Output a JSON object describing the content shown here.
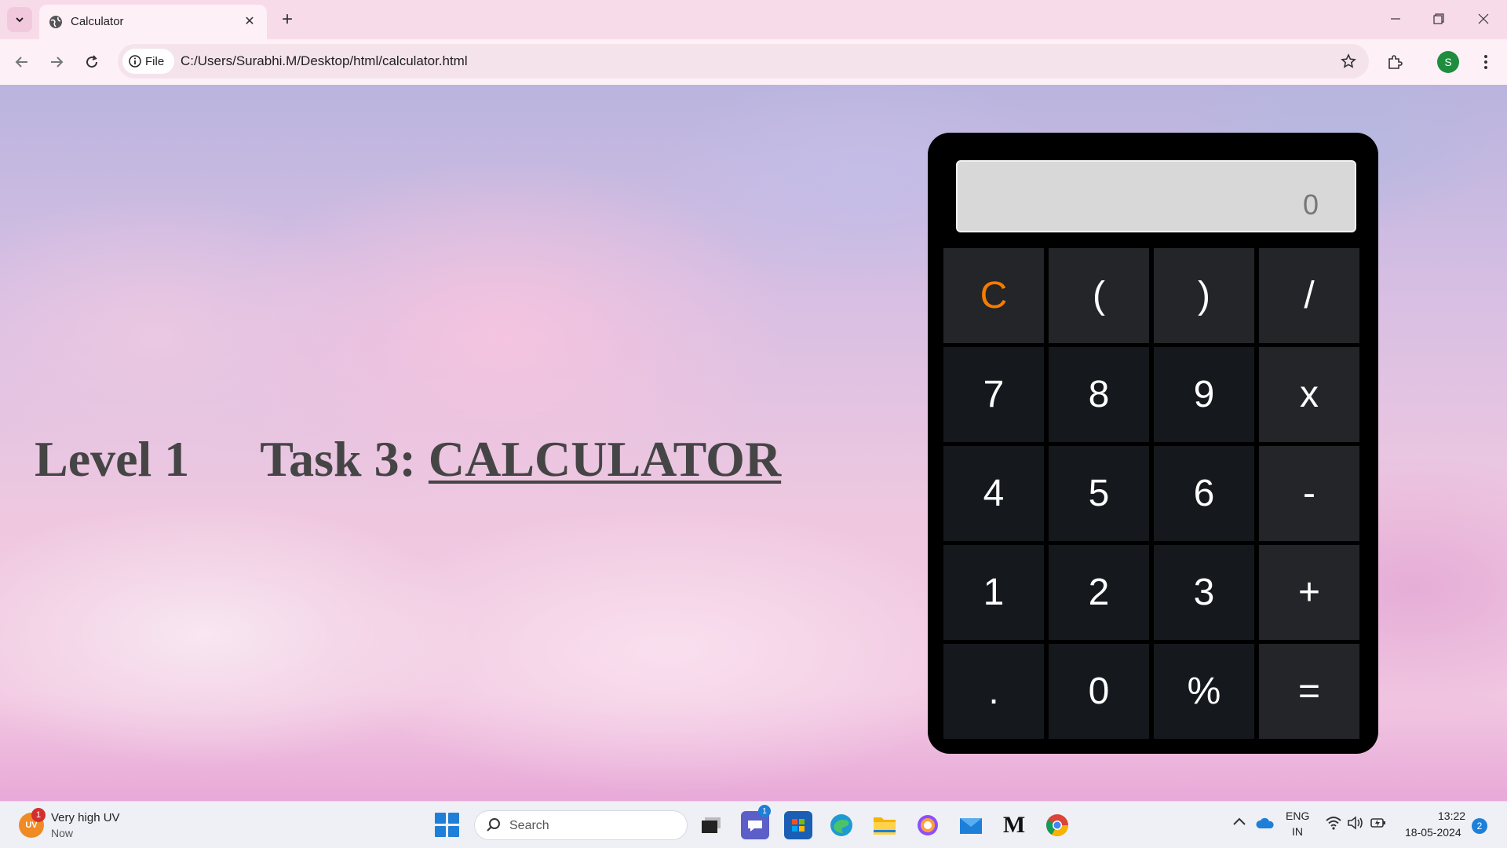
{
  "browser": {
    "tab_title": "Calculator",
    "tab_close": "✕",
    "new_tab": "+",
    "site_chip_label": "File",
    "url": "C:/Users/Surabhi.M/Desktop/html/calculator.html",
    "profile_initial": "S",
    "icons": [
      "tab-list-icon",
      "globe-icon",
      "back-icon",
      "forward-icon",
      "reload-icon",
      "info-icon",
      "star-icon",
      "extensions-icon",
      "menu-icon",
      "minimize-icon",
      "restore-icon",
      "close-icon"
    ]
  },
  "page": {
    "level_text": "Level 1",
    "task_prefix": "Task 3: ",
    "task_title": "CALCULATOR"
  },
  "calculator": {
    "display_value": "0",
    "keys": [
      {
        "label": "C",
        "kind": "clear"
      },
      {
        "label": "(",
        "kind": "func"
      },
      {
        "label": ")",
        "kind": "func"
      },
      {
        "label": "/",
        "kind": "func"
      },
      {
        "label": "7",
        "kind": "digit"
      },
      {
        "label": "8",
        "kind": "digit"
      },
      {
        "label": "9",
        "kind": "digit"
      },
      {
        "label": "x",
        "kind": "func"
      },
      {
        "label": "4",
        "kind": "digit"
      },
      {
        "label": "5",
        "kind": "digit"
      },
      {
        "label": "6",
        "kind": "digit"
      },
      {
        "label": "-",
        "kind": "func"
      },
      {
        "label": "1",
        "kind": "digit"
      },
      {
        "label": "2",
        "kind": "digit"
      },
      {
        "label": "3",
        "kind": "func-digit"
      },
      {
        "label": "+",
        "kind": "func"
      },
      {
        "label": ".",
        "kind": "digit"
      },
      {
        "label": "0",
        "kind": "digit"
      },
      {
        "label": "%",
        "kind": "digit"
      },
      {
        "label": "=",
        "kind": "func"
      }
    ],
    "colors": {
      "clear_key": "#f57c00",
      "key_bg": "#15181c",
      "op_key_bg": "#232528",
      "display_bg": "#d8d8d8"
    }
  },
  "taskbar": {
    "weather_icon_text": "UV",
    "weather_badge": "1",
    "weather_title": "Very high UV",
    "weather_sub": "Now",
    "search_label": "Search",
    "teams_badge": "1",
    "lang_line1": "ENG",
    "lang_line2": "IN",
    "time": "13:22",
    "date": "18-05-2024",
    "notification_count": "2",
    "app_icons": [
      "windows-start-icon",
      "task-view-icon",
      "teams-icon",
      "store-icon",
      "edge-icon",
      "file-explorer-icon",
      "copilot-icon",
      "mail-icon",
      "m-app-icon",
      "chrome-icon"
    ]
  }
}
